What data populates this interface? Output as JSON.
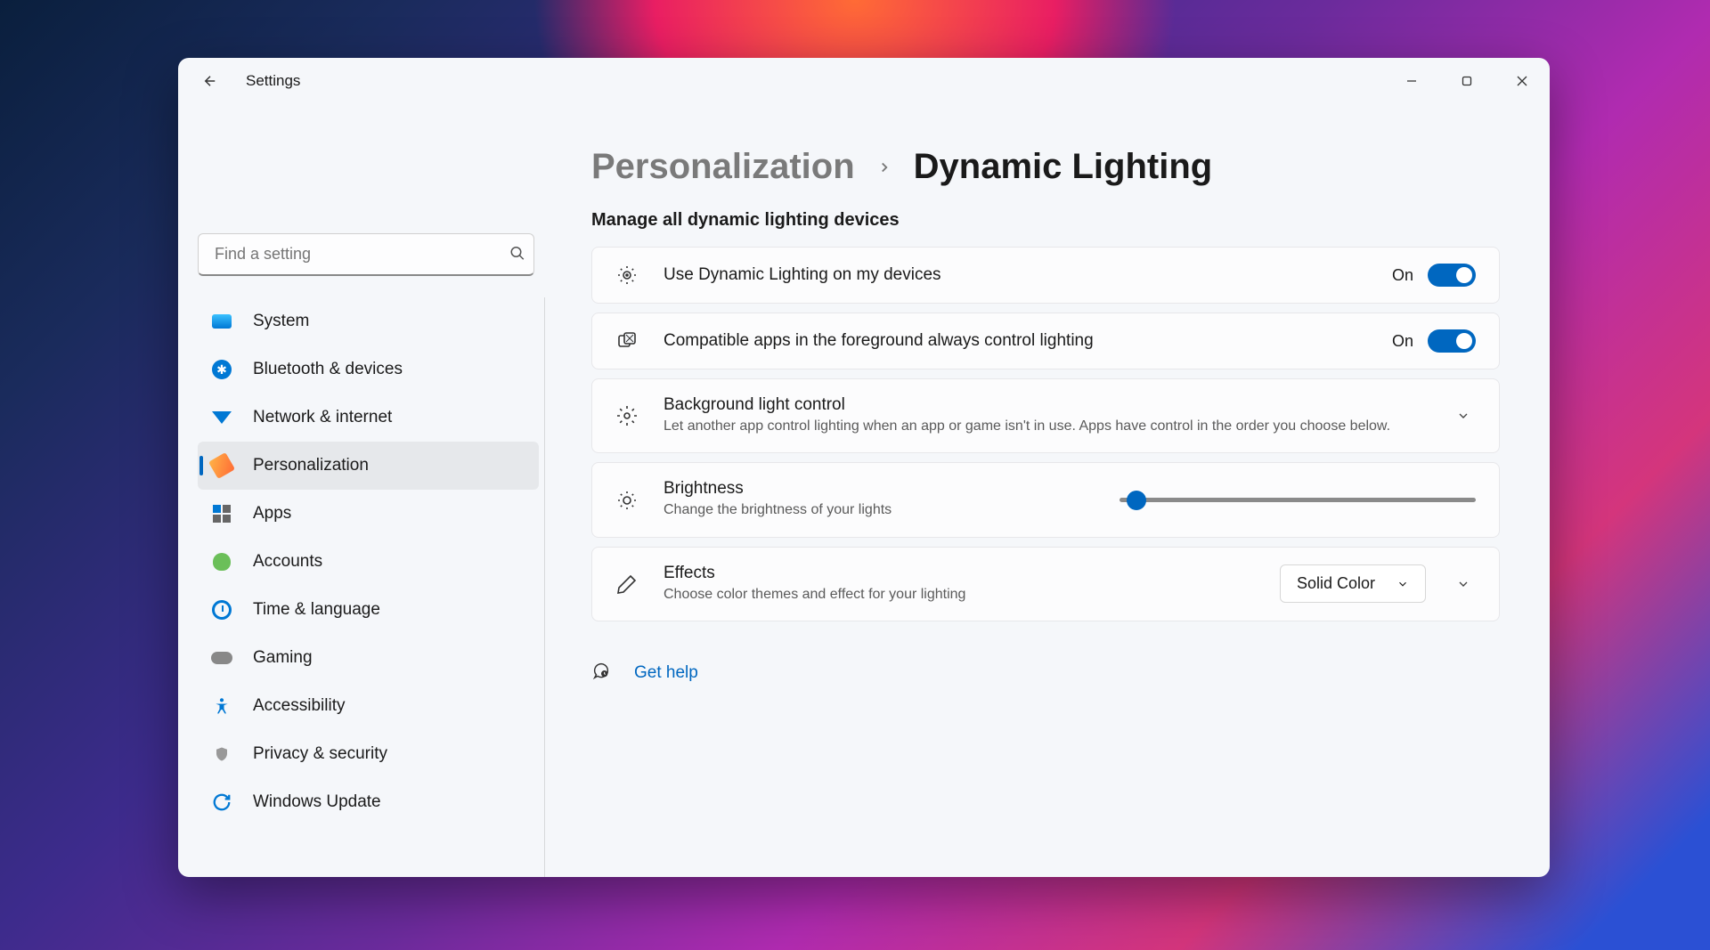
{
  "app_title": "Settings",
  "search": {
    "placeholder": "Find a setting"
  },
  "nav": [
    {
      "label": "System"
    },
    {
      "label": "Bluetooth & devices"
    },
    {
      "label": "Network & internet"
    },
    {
      "label": "Personalization"
    },
    {
      "label": "Apps"
    },
    {
      "label": "Accounts"
    },
    {
      "label": "Time & language"
    },
    {
      "label": "Gaming"
    },
    {
      "label": "Accessibility"
    },
    {
      "label": "Privacy & security"
    },
    {
      "label": "Windows Update"
    }
  ],
  "breadcrumb": {
    "parent": "Personalization",
    "current": "Dynamic Lighting"
  },
  "section": "Manage all dynamic lighting devices",
  "rows": {
    "useDL": {
      "title": "Use Dynamic Lighting on my devices",
      "state": "On"
    },
    "compat": {
      "title": "Compatible apps in the foreground always control lighting",
      "state": "On"
    },
    "bg": {
      "title": "Background light control",
      "sub": "Let another app control lighting when an app or game isn't in use. Apps have control in the order you choose below."
    },
    "bright": {
      "title": "Brightness",
      "sub": "Change the brightness of your lights",
      "value": 2
    },
    "effects": {
      "title": "Effects",
      "sub": "Choose color themes and effect for your lighting",
      "selected": "Solid Color"
    }
  },
  "help": "Get help"
}
